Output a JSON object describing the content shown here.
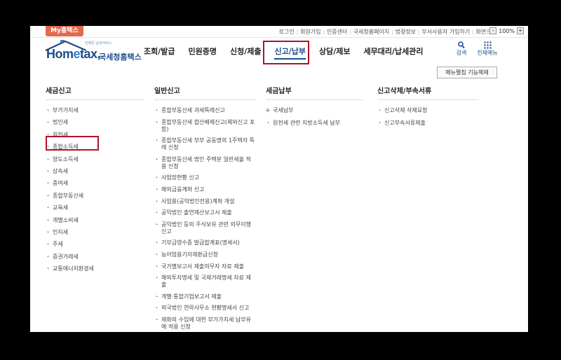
{
  "topbar": {
    "my_tab": "My홈택스",
    "links": [
      "로그인",
      "회원가입",
      "인증센터",
      "국세청홈페이지",
      "법령정보",
      "부서사용자 가입하기",
      "화면크기"
    ],
    "zoom_minus": "-",
    "zoom_value": "100%",
    "zoom_plus": "+"
  },
  "logo": {
    "brand_prefix": "Hom",
    "brand_e": "e",
    "brand_suffix": "tax,",
    "korean": "국세청홈택스",
    "tagline": "언제든 납세서비스"
  },
  "nav": {
    "items": [
      "조회/발급",
      "민원증명",
      "신청/제출",
      "신고/납부",
      "상담/제보",
      "세무대리/납세관리"
    ],
    "search_label": "검색",
    "menu_label": "전체메뉴"
  },
  "setting_button": "메뉴펼침 기능해제",
  "columns": {
    "col1": {
      "title": "세금신고",
      "items": [
        "부가가치세",
        "법인세",
        "원천세",
        "종합소득세",
        "양도소득세",
        "상속세",
        "증여세",
        "종합부동산세",
        "교육세",
        "개별소비세",
        "인지세",
        "주세",
        "증권거래세",
        "교통에너지환경세"
      ]
    },
    "col2": {
      "title": "일반신고",
      "items": [
        "종합부동산세 과세특례신고",
        "종합부동산세 합산배제신고(체외신고 포함)",
        "종합부동산세 부부 공동명의 1주택자 특례 신청",
        "종합부동산세 법인 주택분 일반세율 적용 신청",
        "사업장현황 신고",
        "해외금융계좌 신고",
        "사업용(공익법인전용)계좌 개설",
        "공익법인 출연재산보고서 제출",
        "공익법인 등의 주식보유 관련 의무이행 신고",
        "기부금영수증 발급합계표(명세서)",
        "농어업용기자재환급신청",
        "국가별보고서 제출의무자 자료 제출",
        "해외투자명세 및 국제거래명세 자료 제출",
        "개별·통합기업보고서 제출",
        "외국법인 연락사무소 현황명세서 신고",
        "재화의 수입에 대한 부가가치세 납부유예 적용 신청"
      ]
    },
    "col3": {
      "title": "세금납부",
      "items": [
        "국세납부",
        "원천세 관련 지방소득세 납부"
      ]
    },
    "col4": {
      "title": "신고삭제/부속서류",
      "items": [
        "신고삭제 삭제요청",
        "신고부속서류제출"
      ]
    }
  },
  "colors": {
    "brand": "#1f4d8a",
    "highlight": "#b3122a",
    "my_tab": "#e06a4f"
  }
}
